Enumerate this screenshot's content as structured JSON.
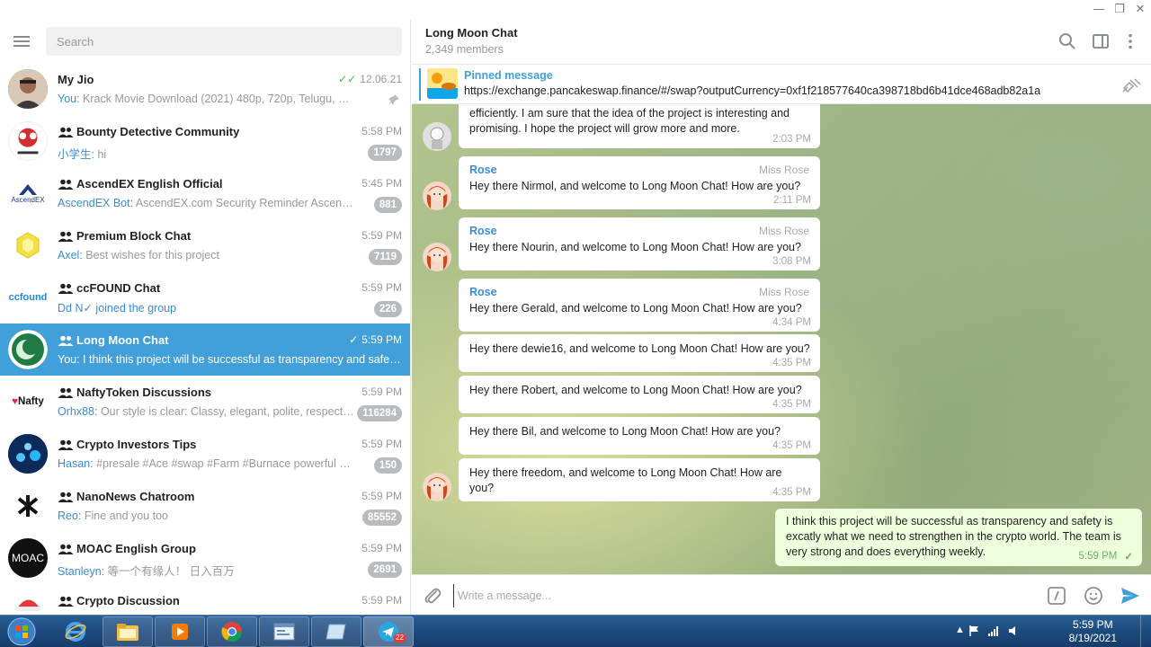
{
  "window": {
    "minimize": "—",
    "maximize": "❐",
    "close": "✕"
  },
  "sidebar": {
    "search_placeholder": "Search",
    "chats": [
      {
        "name": "My Jio",
        "group": false,
        "time": "12.06.21",
        "tick": "✓✓",
        "sender": "You:",
        "preview": " Krack Movie Download (2021) 480p, 720p, Telugu, WEB-DL ...",
        "badge": "",
        "pinned": true
      },
      {
        "name": "Bounty Detective Community",
        "group": true,
        "time": "5:58 PM",
        "sender": "小学生:",
        "preview": " hi",
        "badge": "1797"
      },
      {
        "name": "AscendEX English Official",
        "group": true,
        "time": "5:45 PM",
        "sender": "AscendEX Bot:",
        "preview": " AscendEX.com Security Reminder  AscendEX.c...",
        "badge": "881"
      },
      {
        "name": "Premium Block Chat",
        "group": true,
        "time": "5:59 PM",
        "sender": "Axel:",
        "preview": " Best wishes for this project",
        "badge": "7119"
      },
      {
        "name": "ccFOUND Chat",
        "group": true,
        "time": "5:59 PM",
        "sender": "Dd N✓ joined the group",
        "preview": "",
        "badge": "226"
      },
      {
        "name": "Long Moon Chat",
        "group": true,
        "time": "5:59 PM",
        "tick": "✓",
        "sender": "You:",
        "preview": " I think this project will be successful as transparency and safet...",
        "badge": "",
        "active": true
      },
      {
        "name": "NaftyToken Discussions",
        "group": true,
        "time": "5:59 PM",
        "sender": "Orhx88:",
        "preview": " Our style is clear: Classy, elegant, polite, respectful",
        "badge": "116284"
      },
      {
        "name": "Crypto Investors Tips",
        "group": true,
        "time": "5:59 PM",
        "sender": "Hasan:",
        "preview": " #presale #Ace #swap #Farm #Burnace powerful proje...",
        "badge": "150"
      },
      {
        "name": "NanoNews Chatroom",
        "group": true,
        "time": "5:59 PM",
        "sender": "Reo:",
        "preview": " Fine and you too",
        "badge": "85552"
      },
      {
        "name": "MOAC English Group",
        "group": true,
        "time": "5:59 PM",
        "sender": "Stanleyn:",
        "preview": " 等一个有缘人！ 日入百万",
        "badge": "2691"
      },
      {
        "name": "Crypto Discussion",
        "group": true,
        "time": "5:59 PM",
        "sender": "",
        "preview": "",
        "badge": ""
      }
    ],
    "avatar_texts": {
      "bounty": "BOUNTY DETECTIVE",
      "ascend": "AscendEX",
      "ccfound": "ccfound",
      "nafty": "Nafty",
      "moac": "MOAC"
    }
  },
  "header": {
    "title": "Long Moon Chat",
    "members": "2,349 members"
  },
  "pinned": {
    "title": "Pinned message",
    "text": "https://exchange.pancakeswap.finance/#/swap?outputCurrency=0xf1f218577640ca398718bd6b41dce468adb82a1a"
  },
  "messages": {
    "m0": {
      "text": "This is a very high quality and reliable project. The team is working efficiently. I am sure that the idea of the project is interesting and promising. I hope the project will grow more and more.",
      "time": "2:03 PM"
    },
    "m1": {
      "author": "Rose",
      "role": "Miss Rose",
      "text": "Hey there Nirmol, and welcome to Long Moon Chat! How are you?",
      "time": "2:11 PM"
    },
    "m2": {
      "author": "Rose",
      "role": "Miss Rose",
      "text": "Hey there Nourin, and welcome to Long Moon Chat! How are you?",
      "time": "3:08 PM"
    },
    "m3": {
      "author": "Rose",
      "role": "Miss Rose",
      "text": "Hey there Gerald, and welcome to Long Moon Chat! How are you?",
      "time": "4:34 PM"
    },
    "m4": {
      "text": "Hey there dewie16, and welcome to Long Moon Chat! How are you?",
      "time": "4:35 PM"
    },
    "m5": {
      "text": "Hey there Robert, and welcome to Long Moon Chat! How are you?",
      "time": "4:35 PM"
    },
    "m6": {
      "text": "Hey there Bil, and welcome to Long Moon Chat! How are you?",
      "time": "4:35 PM"
    },
    "m7": {
      "text": "Hey there freedom, and welcome to Long Moon Chat! How are you?",
      "time": "4:35 PM"
    },
    "m8": {
      "text": "I think this project will be successful as transparency and safety is excatly what we need to strengthen in the crypto world. The team is very strong and does everything weekly.",
      "time": "5:59 PM",
      "tick": "✓"
    }
  },
  "composer": {
    "placeholder": "Write a message..."
  },
  "taskbar": {
    "telegram_badge": "22",
    "time": "5:59 PM",
    "date": "8/19/2021"
  },
  "colors": {
    "accent": "#419fd9",
    "badge": "#b9bcbf",
    "outgoing_bubble": "#eeffde",
    "check_green": "#4fae4e"
  }
}
